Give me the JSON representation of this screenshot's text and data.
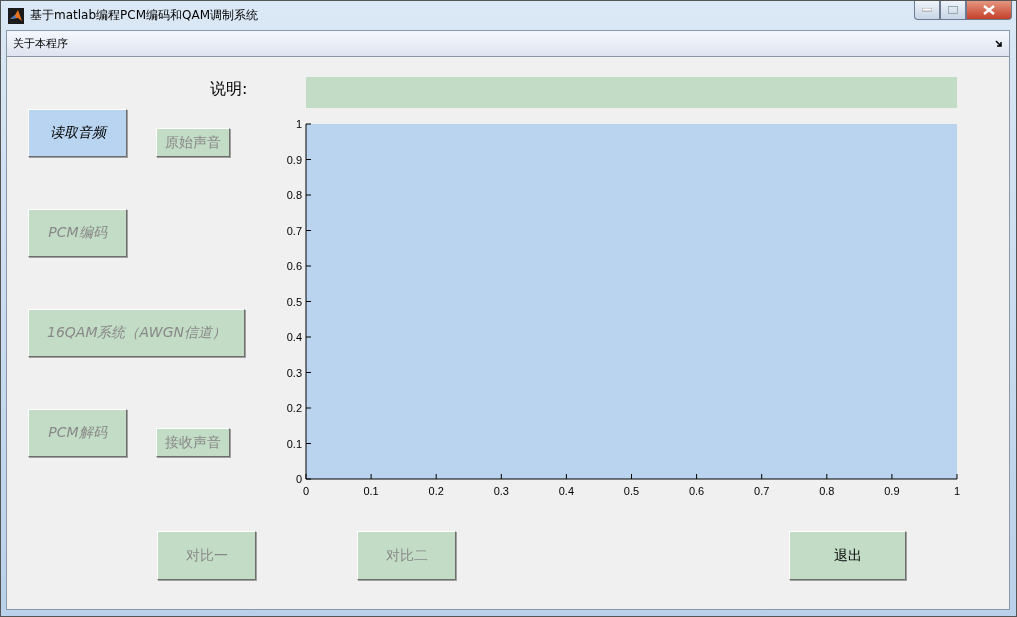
{
  "window": {
    "title": "基于matlab编程PCM编码和QAM调制系统"
  },
  "menu_bar": {
    "items": [
      "关于本程序"
    ]
  },
  "description": {
    "label": "说明:"
  },
  "buttons": [
    {
      "label": "读取音频",
      "disabled": false,
      "italic": true,
      "color": "#b9d4f1"
    },
    {
      "label": "原始声音",
      "disabled": true,
      "italic": false,
      "color": "#c3dcc6"
    },
    {
      "label": "PCM编码",
      "disabled": true,
      "italic": true,
      "color": "#c3dcc6"
    },
    {
      "label": "16QAM系统（AWGN信道）",
      "disabled": true,
      "italic": true,
      "color": "#c3dcc6"
    },
    {
      "label": "PCM解码",
      "disabled": true,
      "italic": true,
      "color": "#c3dcc6"
    },
    {
      "label": "接收声音",
      "disabled": true,
      "italic": false,
      "color": "#c3dcc6"
    },
    {
      "label": "对比一",
      "disabled": true,
      "italic": false,
      "color": "#c3dcc6"
    },
    {
      "label": "对比二",
      "disabled": true,
      "italic": false,
      "color": "#c3dcc6"
    },
    {
      "label": "退出",
      "disabled": false,
      "italic": false,
      "color": "#c3dcc6"
    }
  ],
  "axes": {
    "chart_data": {
      "type": "line",
      "xlim": [
        0,
        1
      ],
      "ylim": [
        0,
        1
      ],
      "xticks": [
        {
          "value": 0,
          "label": "0"
        },
        {
          "value": 0.1,
          "label": "0.1"
        },
        {
          "value": 0.2,
          "label": "0.2"
        },
        {
          "value": 0.3,
          "label": "0.3"
        },
        {
          "value": 0.4,
          "label": "0.4"
        },
        {
          "value": 0.5,
          "label": "0.5"
        },
        {
          "value": 0.6,
          "label": "0.6"
        },
        {
          "value": 0.7,
          "label": "0.7"
        },
        {
          "value": 0.8,
          "label": "0.8"
        },
        {
          "value": 0.9,
          "label": "0.9"
        },
        {
          "value": 1,
          "label": "1"
        }
      ],
      "yticks": [
        {
          "value": 0,
          "label": "0"
        },
        {
          "value": 0.1,
          "label": "0.1"
        },
        {
          "value": 0.2,
          "label": "0.2"
        },
        {
          "value": 0.3,
          "label": "0.3"
        },
        {
          "value": 0.4,
          "label": "0.4"
        },
        {
          "value": 0.5,
          "label": "0.5"
        },
        {
          "value": 0.6,
          "label": "0.6"
        },
        {
          "value": 0.7,
          "label": "0.7"
        },
        {
          "value": 0.8,
          "label": "0.8"
        },
        {
          "value": 0.9,
          "label": "0.9"
        },
        {
          "value": 1,
          "label": "1"
        }
      ]
    }
  }
}
